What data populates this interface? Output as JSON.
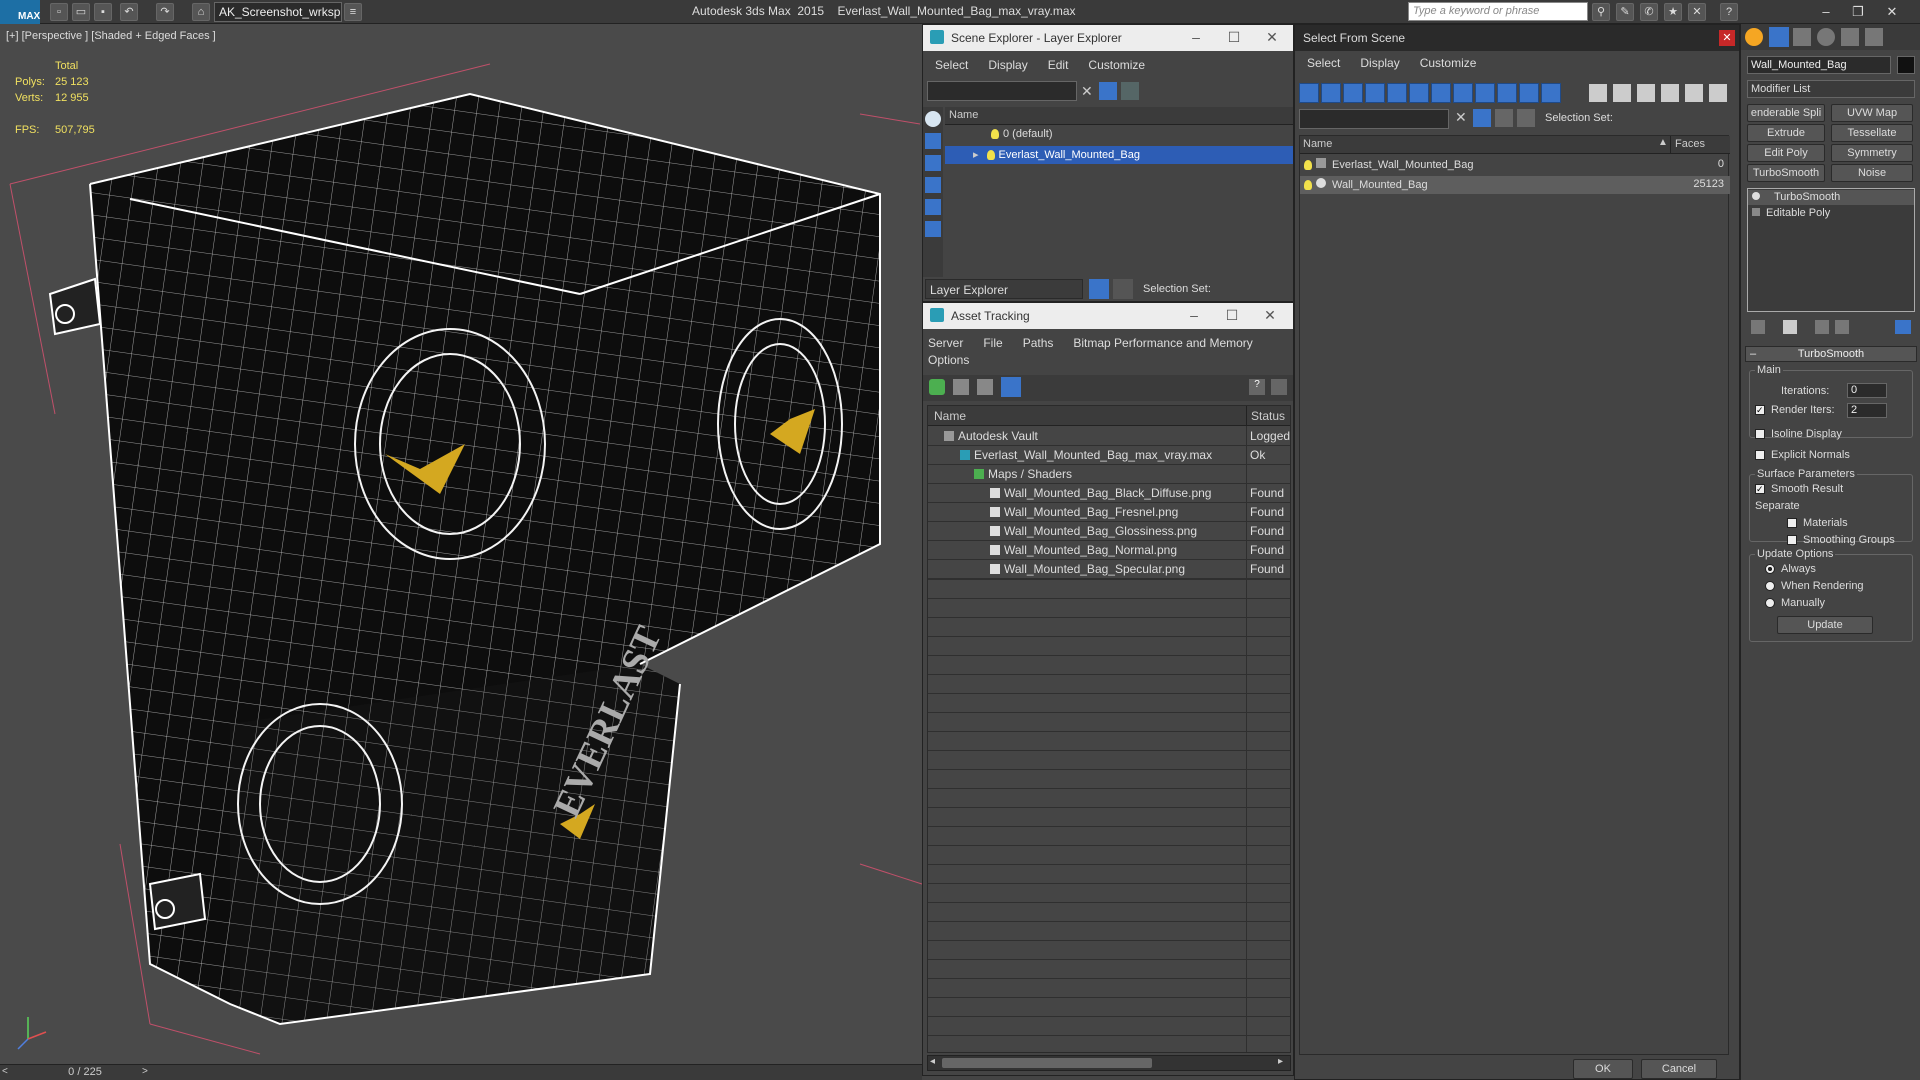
{
  "titlebar": {
    "app_logo": "MAX",
    "workspace": "AK_Screenshot_wrksp",
    "app_name": "Autodesk 3ds Max  2015",
    "file_name": "Everlast_Wall_Mounted_Bag_max_vray.max",
    "search_placeholder": "Type a keyword or phrase"
  },
  "viewport": {
    "label": "[+] [Perspective ] [Shaded + Edged Faces ]",
    "stats": {
      "total_label": "Total",
      "polys_label": "Polys:",
      "polys_value": "25 123",
      "verts_label": "Verts:",
      "verts_value": "12 955",
      "fps_label": "FPS:",
      "fps_value": "507,795"
    },
    "frame_counter": "0 / 225"
  },
  "scene_explorer": {
    "title": "Scene Explorer - Layer Explorer",
    "menu": [
      "Select",
      "Display",
      "Edit",
      "Customize"
    ],
    "col_name": "Name",
    "layers": [
      "0 (default)",
      "Everlast_Wall_Mounted_Bag"
    ],
    "footer_dropdown": "Layer Explorer",
    "selection_set_label": "Selection Set:"
  },
  "asset_tracking": {
    "title": "Asset Tracking",
    "menu": [
      "Server",
      "File",
      "Paths",
      "Bitmap Performance and Memory"
    ],
    "menu2": "Options",
    "col_name": "Name",
    "col_status": "Status",
    "rows": [
      {
        "name": "Autodesk Vault",
        "status": "Logged"
      },
      {
        "name": "Everlast_Wall_Mounted_Bag_max_vray.max",
        "status": "Ok"
      },
      {
        "name": "Maps / Shaders",
        "status": ""
      },
      {
        "name": "Wall_Mounted_Bag_Black_Diffuse.png",
        "status": "Found"
      },
      {
        "name": "Wall_Mounted_Bag_Fresnel.png",
        "status": "Found"
      },
      {
        "name": "Wall_Mounted_Bag_Glossiness.png",
        "status": "Found"
      },
      {
        "name": "Wall_Mounted_Bag_Normal.png",
        "status": "Found"
      },
      {
        "name": "Wall_Mounted_Bag_Specular.png",
        "status": "Found"
      }
    ]
  },
  "select_from_scene": {
    "title": "Select From Scene",
    "menu": [
      "Select",
      "Display",
      "Customize"
    ],
    "selection_set_label": "Selection Set:",
    "col_name": "Name",
    "col_faces": "Faces",
    "rows": [
      {
        "name": "Everlast_Wall_Mounted_Bag",
        "faces": "0"
      },
      {
        "name": "Wall_Mounted_Bag",
        "faces": "25123"
      }
    ],
    "ok": "OK",
    "cancel": "Cancel"
  },
  "command_panel": {
    "object_name": "Wall_Mounted_Bag",
    "modifier_list": "Modifier List",
    "buttons": [
      "enderable Spli",
      "UVW Map",
      "Extrude",
      "Tessellate",
      "Edit Poly",
      "Symmetry",
      "TurboSmooth",
      "Noise"
    ],
    "stack": [
      "TurboSmooth",
      "Editable Poly"
    ],
    "rollout_title": "TurboSmooth",
    "main_label": "Main",
    "iterations_label": "Iterations:",
    "iterations_value": "0",
    "render_iters_label": "Render Iters:",
    "render_iters_value": "2",
    "isoline_label": "Isoline Display",
    "explicit_normals_label": "Explicit Normals",
    "surface_params_label": "Surface Parameters",
    "smooth_result_label": "Smooth Result",
    "separate_label": "Separate",
    "materials_label": "Materials",
    "smoothing_groups_label": "Smoothing Groups",
    "update_options_label": "Update Options",
    "always_label": "Always",
    "when_rendering_label": "When Rendering",
    "manually_label": "Manually",
    "update_button": "Update"
  }
}
